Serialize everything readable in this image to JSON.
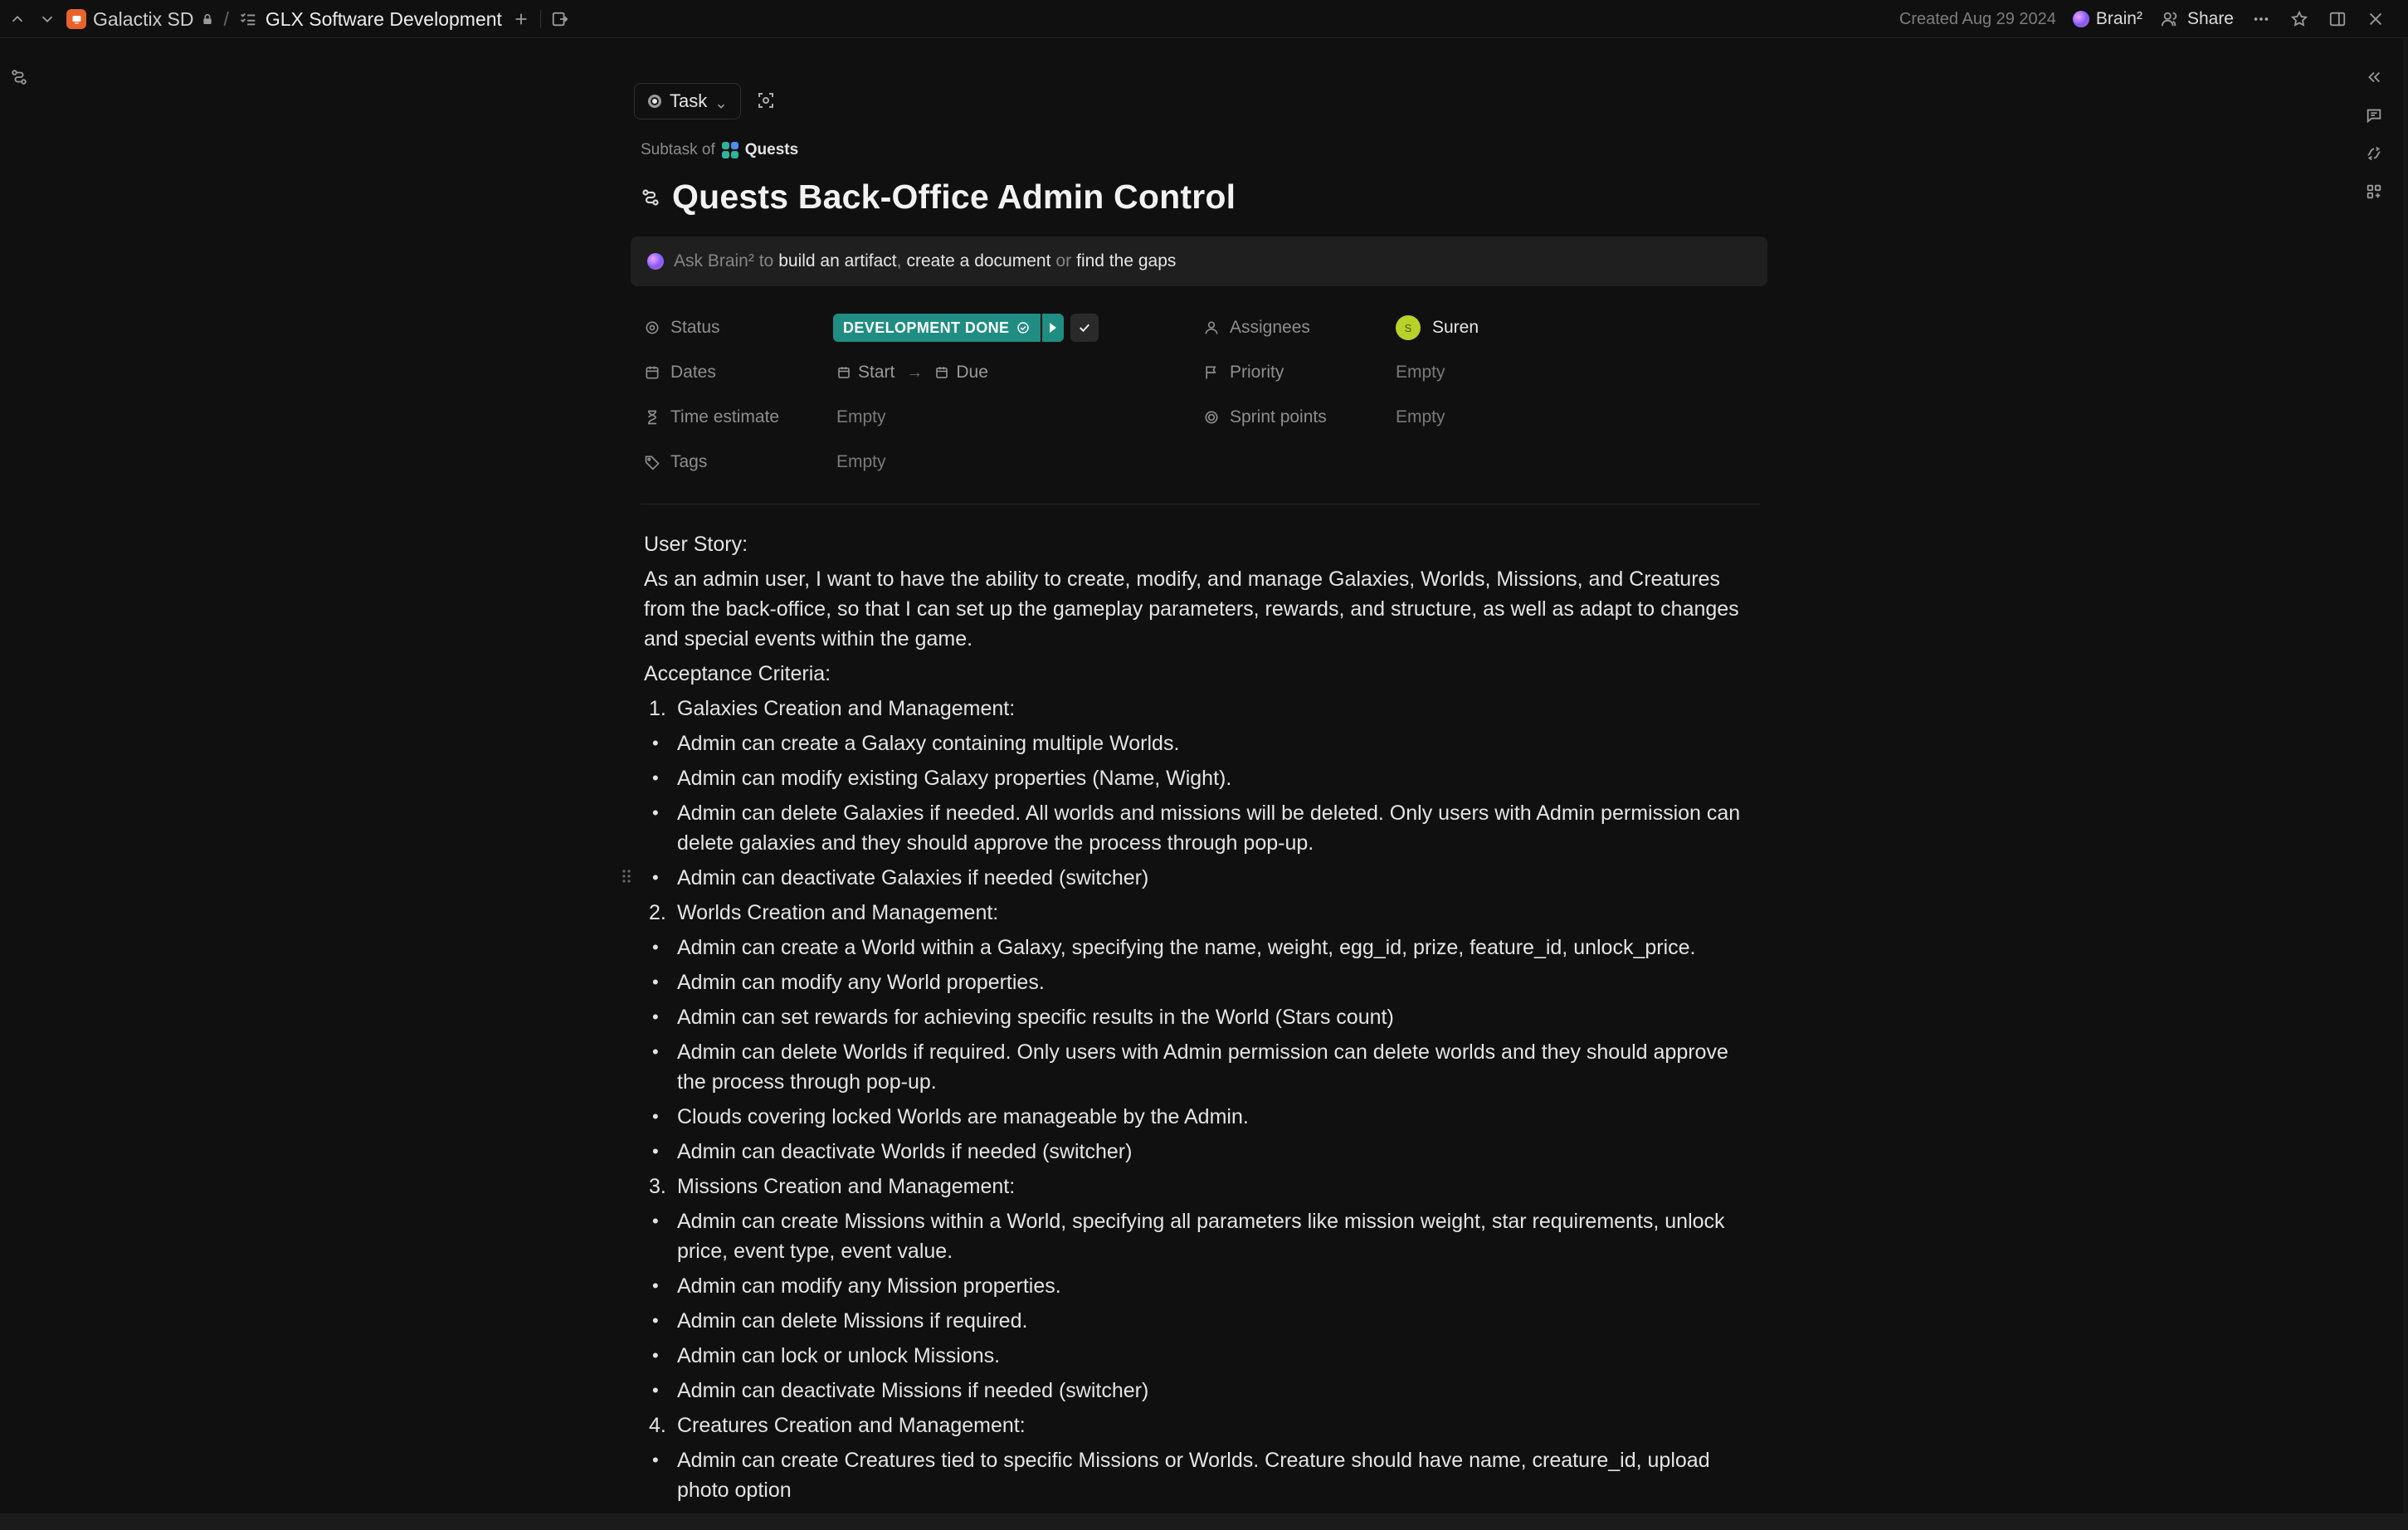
{
  "topbar": {
    "workspace": "Galactix SD",
    "separator": "/",
    "list_name": "GLX Software Development",
    "created": "Created Aug 29 2024",
    "brain_label": "Brain²",
    "share_label": "Share"
  },
  "task": {
    "type_label": "Task",
    "subtask_prefix": "Subtask of",
    "parent": "Quests",
    "title": "Quests Back-Office Admin Control"
  },
  "ai_bar": {
    "prefix": "Ask Brain² to",
    "link1": "build an artifact",
    "sep1": ",",
    "link2": "create a document",
    "or": "or",
    "link3": "find the gaps"
  },
  "properties": {
    "status_label": "Status",
    "status_value": "DEVELOPMENT DONE",
    "dates_label": "Dates",
    "start": "Start",
    "due": "Due",
    "time_label": "Time estimate",
    "time_value": "Empty",
    "tags_label": "Tags",
    "tags_value": "Empty",
    "assignees_label": "Assignees",
    "assignee_initial": "S",
    "assignee_name": "Suren",
    "priority_label": "Priority",
    "priority_value": "Empty",
    "sprint_label": "Sprint points",
    "sprint_value": "Empty"
  },
  "doc": {
    "story_heading": "User Story:",
    "story_text": "As an admin user, I want to have the ability to create, modify, and  manage Galaxies, Worlds, Missions, and Creatures from the back-office,  so that I can set up the gameplay parameters, rewards, and structure, as  well as adapt to changes and special events within the game.",
    "criteria_heading": "Acceptance Criteria:",
    "s1": "Galaxies Creation and Management:",
    "s1_items": [
      "Admin can create a Galaxy containing multiple Worlds.",
      "Admin can modify existing Galaxy properties (Name, Wight).",
      "Admin can delete Galaxies if needed. All worlds and missions will be  deleted. Only users with Admin permission can delete galaxies and they  should approve the process through pop-up.",
      "Admin can deactivate Galaxies if needed (switcher)"
    ],
    "s2": "Worlds Creation and Management:",
    "s2_items": [
      "Admin can create a World within a Galaxy, specifying the name, weight, egg_id, prize, feature_id, unlock_price.",
      "Admin can modify any World properties.",
      "Admin can set rewards for achieving specific results in the World (Stars count)",
      "Admin can delete Worlds if required. Only users with Admin  permission can delete worlds and they should approve the process through  pop-up.",
      "Clouds covering locked Worlds are manageable by the Admin.",
      "Admin can deactivate Worlds if needed (switcher)"
    ],
    "s3": "Missions Creation and Management:",
    "s3_items": [
      "Admin can create Missions within a World, specifying all parameters  like mission weight, star requirements, unlock price, event type, event  value.",
      "Admin can modify any Mission properties.",
      "Admin can delete Missions if required.",
      "Admin can lock or unlock Missions.",
      "Admin can deactivate Missions if needed (switcher)"
    ],
    "s4": "Creatures Creation and Management:",
    "s4_items": [
      "Admin can create Creatures tied to specific Missions or Worlds. Creature should have name, creature_id, upload photo option"
    ]
  }
}
